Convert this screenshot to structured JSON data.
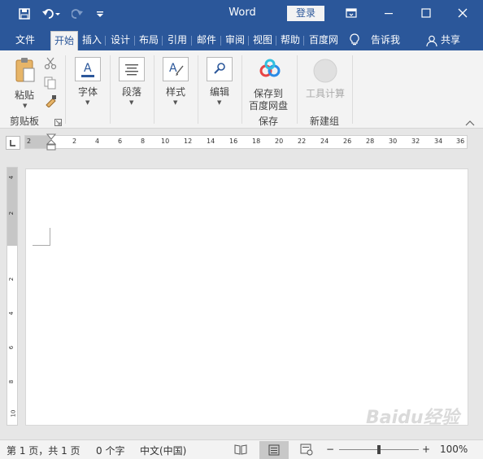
{
  "window": {
    "app_title": "Word",
    "login_label": "登录"
  },
  "colors": {
    "brand": "#2b579a",
    "ribbon_bg": "#f3f3f3",
    "workspace_bg": "#e6e6e6"
  },
  "icons": {
    "save": "save-icon",
    "undo": "undo-icon",
    "redo": "redo-icon",
    "customize": "customize-quick-access-icon",
    "ribbon_display": "ribbon-display-options-icon",
    "minimize": "minimize-icon",
    "maximize": "maximize-icon",
    "close": "close-icon",
    "tell_me": "lightbulb-icon",
    "share": "share-person-icon"
  },
  "tabs": [
    "文件",
    "开始",
    "插入",
    "设计",
    "布局",
    "引用",
    "邮件",
    "审阅",
    "视图",
    "帮助",
    "百度网"
  ],
  "active_tab": "开始",
  "tell_me": "告诉我",
  "share": "共享",
  "ribbon": {
    "paste": "粘贴",
    "clipboard_group": "剪贴板",
    "font": "字体",
    "paragraph": "段落",
    "styles": "样式",
    "editing": "编辑",
    "save_baidu_line1": "保存到",
    "save_baidu_line2": "百度网盘",
    "save_group": "保存",
    "tool_calc": "工具计算",
    "new_group": "新建组",
    "collapse_ribbon": "^"
  },
  "hruler_ticks": [
    "2",
    "2",
    "4",
    "6",
    "8",
    "10",
    "12",
    "14",
    "16",
    "18",
    "20",
    "22",
    "24",
    "26",
    "28",
    "30",
    "32",
    "34",
    "36"
  ],
  "vruler_ticks": [
    "4",
    "2",
    "2",
    "4",
    "6",
    "8",
    "10"
  ],
  "status": {
    "page": "第 1 页，共 1 页",
    "words": "0 个字",
    "language": "中文(中国)",
    "zoom_minus": "−",
    "zoom_plus": "+",
    "zoom": "100%"
  },
  "watermark": "Baidu经验"
}
